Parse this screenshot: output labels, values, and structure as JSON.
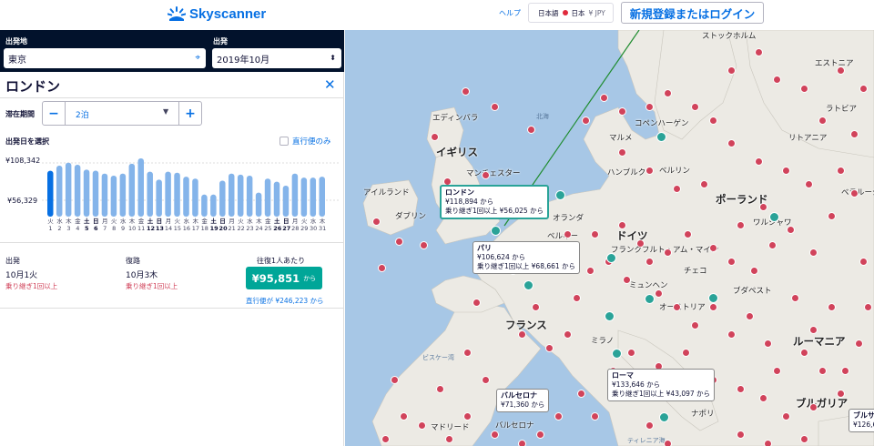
{
  "header": {
    "brand": "Skyscanner",
    "help": "ヘルプ",
    "locale_lang": "日本語",
    "locale_region": "日本",
    "locale_currency": "¥ JPY",
    "login": "新規登録またはログイン"
  },
  "search": {
    "origin_label": "出発地",
    "origin_value": "東京",
    "depart_label": "出発",
    "depart_value": "2019年10月",
    "destination": "ロンドン",
    "stay_label": "滞在期間",
    "stay_value": "2泊",
    "date_label": "出発日を選択",
    "direct_only": "直行便のみ"
  },
  "chart_data": {
    "type": "bar",
    "y_max_label": "¥108,342",
    "y_mid_label": "¥56,329",
    "days": [
      {
        "w": "火",
        "d": "1"
      },
      {
        "w": "水",
        "d": "2"
      },
      {
        "w": "木",
        "d": "3"
      },
      {
        "w": "金",
        "d": "4"
      },
      {
        "w": "土",
        "d": "5"
      },
      {
        "w": "日",
        "d": "6"
      },
      {
        "w": "月",
        "d": "7"
      },
      {
        "w": "火",
        "d": "8"
      },
      {
        "w": "水",
        "d": "9"
      },
      {
        "w": "木",
        "d": "10"
      },
      {
        "w": "金",
        "d": "11"
      },
      {
        "w": "土",
        "d": "12"
      },
      {
        "w": "日",
        "d": "13"
      },
      {
        "w": "月",
        "d": "14"
      },
      {
        "w": "火",
        "d": "15"
      },
      {
        "w": "水",
        "d": "16"
      },
      {
        "w": "木",
        "d": "17"
      },
      {
        "w": "金",
        "d": "18"
      },
      {
        "w": "土",
        "d": "19"
      },
      {
        "w": "日",
        "d": "20"
      },
      {
        "w": "月",
        "d": "21"
      },
      {
        "w": "火",
        "d": "22"
      },
      {
        "w": "水",
        "d": "23"
      },
      {
        "w": "木",
        "d": "24"
      },
      {
        "w": "金",
        "d": "25"
      },
      {
        "w": "土",
        "d": "26"
      },
      {
        "w": "日",
        "d": "27"
      },
      {
        "w": "月",
        "d": "28"
      },
      {
        "w": "火",
        "d": "29"
      },
      {
        "w": "水",
        "d": "30"
      },
      {
        "w": "木",
        "d": "31"
      }
    ],
    "values": [
      95851,
      101000,
      104000,
      102000,
      97000,
      96000,
      93000,
      91000,
      93000,
      103000,
      108342,
      95000,
      87000,
      95000,
      94000,
      90000,
      88000,
      72000,
      72000,
      86000,
      93000,
      92000,
      91000,
      74000,
      88000,
      85000,
      81000,
      93000,
      89000,
      89000,
      90000
    ],
    "selected_index": 0
  },
  "summary": {
    "out_label": "出発",
    "out_date": "10月1火",
    "out_note": "乗り継ぎ1回以上",
    "ret_label": "復路",
    "ret_date": "10月3木",
    "ret_note": "乗り継ぎ1回以上",
    "per_person": "往復1人あたり",
    "price": "¥95,851",
    "price_suffix": "から",
    "direct_price": "直行便が ¥246,223 から"
  },
  "map": {
    "countries": [
      "イギリス",
      "フランス",
      "ドイツ",
      "ポーランド",
      "ルーマニア",
      "ブルガリア",
      "チェコ",
      "オーストリア",
      "リトアニア",
      "ラトビア",
      "エストニア",
      "ベラルーシ",
      "アイルランド",
      "オランダ",
      "ベルギー"
    ],
    "cities": [
      "エディンバラ",
      "マンチェスター",
      "ダブリン",
      "ハンブルク",
      "ベルリン",
      "ワルシャワ",
      "フランクフルト・アム・マイン",
      "ミュンヘン",
      "ブダペスト",
      "コペンハーゲン",
      "マルメ",
      "ストックホルム",
      "ミラノ",
      "マドリード",
      "バルセロナ",
      "ナポリ",
      "ビスケー湾",
      "北海",
      "ティレニア海"
    ],
    "tips": [
      {
        "title": "ロンドン",
        "price": "¥118,894 から",
        "note": "乗り継ぎ1回以上 ¥56,025 から"
      },
      {
        "title": "パリ",
        "price": "¥106,624 から",
        "note": "乗り継ぎ1回以上 ¥68,661 から"
      },
      {
        "title": "ローマ",
        "price": "¥133,646 から",
        "note": "乗り継ぎ1回以上 ¥43,097 から"
      },
      {
        "title": "バルセロナ",
        "price": "¥71,360 から",
        "note": ""
      },
      {
        "title": "ブルサ",
        "price": "¥126,6",
        "note": ""
      }
    ]
  }
}
